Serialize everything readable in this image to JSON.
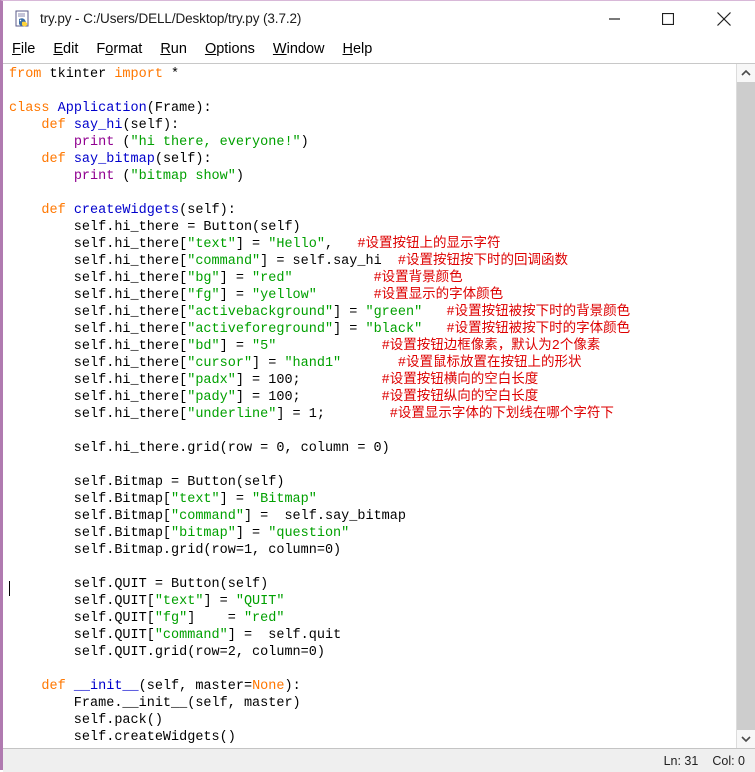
{
  "window": {
    "title": "try.py - C:/Users/DELL/Desktop/try.py (3.7.2)",
    "icon": "python-idle-icon",
    "controls": {
      "minimize": "minimize-icon",
      "maximize": "maximize-icon",
      "close": "close-icon"
    }
  },
  "menubar": {
    "items": [
      {
        "label": "File",
        "accel": "F"
      },
      {
        "label": "Edit",
        "accel": "E"
      },
      {
        "label": "Format",
        "accel": "o"
      },
      {
        "label": "Run",
        "accel": "R"
      },
      {
        "label": "Options",
        "accel": "O"
      },
      {
        "label": "Window",
        "accel": "W"
      },
      {
        "label": "Help",
        "accel": "H"
      }
    ]
  },
  "editor": {
    "lines": [
      [
        {
          "t": "from",
          "c": "kw"
        },
        {
          "t": " tkinter ",
          "c": "pl"
        },
        {
          "t": "import",
          "c": "kw"
        },
        {
          "t": " *",
          "c": "pl"
        }
      ],
      [],
      [
        {
          "t": "class",
          "c": "kw"
        },
        {
          "t": " ",
          "c": "pl"
        },
        {
          "t": "Application",
          "c": "fn"
        },
        {
          "t": "(Frame):",
          "c": "pl"
        }
      ],
      [
        {
          "t": "    ",
          "c": "pl"
        },
        {
          "t": "def",
          "c": "kw"
        },
        {
          "t": " ",
          "c": "pl"
        },
        {
          "t": "say_hi",
          "c": "fn"
        },
        {
          "t": "(self):",
          "c": "pl"
        }
      ],
      [
        {
          "t": "        ",
          "c": "pl"
        },
        {
          "t": "print",
          "c": "bi"
        },
        {
          "t": " (",
          "c": "pl"
        },
        {
          "t": "\"hi there, everyone!\"",
          "c": "str"
        },
        {
          "t": ")",
          "c": "pl"
        }
      ],
      [
        {
          "t": "    ",
          "c": "pl"
        },
        {
          "t": "def",
          "c": "kw"
        },
        {
          "t": " ",
          "c": "pl"
        },
        {
          "t": "say_bitmap",
          "c": "fn"
        },
        {
          "t": "(self):",
          "c": "pl"
        }
      ],
      [
        {
          "t": "        ",
          "c": "pl"
        },
        {
          "t": "print",
          "c": "bi"
        },
        {
          "t": " (",
          "c": "pl"
        },
        {
          "t": "\"bitmap show\"",
          "c": "str"
        },
        {
          "t": ")",
          "c": "pl"
        }
      ],
      [],
      [
        {
          "t": "    ",
          "c": "pl"
        },
        {
          "t": "def",
          "c": "kw"
        },
        {
          "t": " ",
          "c": "pl"
        },
        {
          "t": "createWidgets",
          "c": "fn"
        },
        {
          "t": "(self):",
          "c": "pl"
        }
      ],
      [
        {
          "t": "        self.hi_there = Button(self)",
          "c": "pl"
        }
      ],
      [
        {
          "t": "        self.hi_there[",
          "c": "pl"
        },
        {
          "t": "\"text\"",
          "c": "str"
        },
        {
          "t": "] = ",
          "c": "pl"
        },
        {
          "t": "\"Hello\"",
          "c": "str"
        },
        {
          "t": ",   ",
          "c": "pl"
        },
        {
          "t": "#设置按钮上的显示字符",
          "c": "cmt"
        }
      ],
      [
        {
          "t": "        self.hi_there[",
          "c": "pl"
        },
        {
          "t": "\"command\"",
          "c": "str"
        },
        {
          "t": "] = self.say_hi  ",
          "c": "pl"
        },
        {
          "t": "#设置按钮按下时的回调函数",
          "c": "cmt"
        }
      ],
      [
        {
          "t": "        self.hi_there[",
          "c": "pl"
        },
        {
          "t": "\"bg\"",
          "c": "str"
        },
        {
          "t": "] = ",
          "c": "pl"
        },
        {
          "t": "\"red\"",
          "c": "str"
        },
        {
          "t": "          ",
          "c": "pl"
        },
        {
          "t": "#设置背景颜色",
          "c": "cmt"
        }
      ],
      [
        {
          "t": "        self.hi_there[",
          "c": "pl"
        },
        {
          "t": "\"fg\"",
          "c": "str"
        },
        {
          "t": "] = ",
          "c": "pl"
        },
        {
          "t": "\"yellow\"",
          "c": "str"
        },
        {
          "t": "       ",
          "c": "pl"
        },
        {
          "t": "#设置显示的字体颜色",
          "c": "cmt"
        }
      ],
      [
        {
          "t": "        self.hi_there[",
          "c": "pl"
        },
        {
          "t": "\"activebackground\"",
          "c": "str"
        },
        {
          "t": "] = ",
          "c": "pl"
        },
        {
          "t": "\"green\"",
          "c": "str"
        },
        {
          "t": "   ",
          "c": "pl"
        },
        {
          "t": "#设置按钮被按下时的背景颜色",
          "c": "cmt"
        }
      ],
      [
        {
          "t": "        self.hi_there[",
          "c": "pl"
        },
        {
          "t": "\"activeforeground\"",
          "c": "str"
        },
        {
          "t": "] = ",
          "c": "pl"
        },
        {
          "t": "\"black\"",
          "c": "str"
        },
        {
          "t": "   ",
          "c": "pl"
        },
        {
          "t": "#设置按钮被按下时的字体颜色",
          "c": "cmt"
        }
      ],
      [
        {
          "t": "        self.hi_there[",
          "c": "pl"
        },
        {
          "t": "\"bd\"",
          "c": "str"
        },
        {
          "t": "] = ",
          "c": "pl"
        },
        {
          "t": "\"5\"",
          "c": "str"
        },
        {
          "t": "             ",
          "c": "pl"
        },
        {
          "t": "#设置按钮边框像素，默认为2个像素",
          "c": "cmt"
        }
      ],
      [
        {
          "t": "        self.hi_there[",
          "c": "pl"
        },
        {
          "t": "\"cursor\"",
          "c": "str"
        },
        {
          "t": "] = ",
          "c": "pl"
        },
        {
          "t": "\"hand1\"",
          "c": "str"
        },
        {
          "t": "       ",
          "c": "pl"
        },
        {
          "t": "#设置鼠标放置在按钮上的形状",
          "c": "cmt"
        }
      ],
      [
        {
          "t": "        self.hi_there[",
          "c": "pl"
        },
        {
          "t": "\"padx\"",
          "c": "str"
        },
        {
          "t": "] = 100;          ",
          "c": "pl"
        },
        {
          "t": "#设置按钮横向的空白长度",
          "c": "cmt"
        }
      ],
      [
        {
          "t": "        self.hi_there[",
          "c": "pl"
        },
        {
          "t": "\"pady\"",
          "c": "str"
        },
        {
          "t": "] = 100;          ",
          "c": "pl"
        },
        {
          "t": "#设置按钮纵向的空白长度",
          "c": "cmt"
        }
      ],
      [
        {
          "t": "        self.hi_there[",
          "c": "pl"
        },
        {
          "t": "\"underline\"",
          "c": "str"
        },
        {
          "t": "] = 1;        ",
          "c": "pl"
        },
        {
          "t": "#设置显示字体的下划线在哪个字符下",
          "c": "cmt"
        }
      ],
      [],
      [
        {
          "t": "        self.hi_there.grid(row = 0, column = 0)",
          "c": "pl"
        }
      ],
      [],
      [
        {
          "t": "        self.Bitmap = Button(self)",
          "c": "pl"
        }
      ],
      [
        {
          "t": "        self.Bitmap[",
          "c": "pl"
        },
        {
          "t": "\"text\"",
          "c": "str"
        },
        {
          "t": "] = ",
          "c": "pl"
        },
        {
          "t": "\"Bitmap\"",
          "c": "str"
        }
      ],
      [
        {
          "t": "        self.Bitmap[",
          "c": "pl"
        },
        {
          "t": "\"command\"",
          "c": "str"
        },
        {
          "t": "] =  self.say_bitmap",
          "c": "pl"
        }
      ],
      [
        {
          "t": "        self.Bitmap[",
          "c": "pl"
        },
        {
          "t": "\"bitmap\"",
          "c": "str"
        },
        {
          "t": "] = ",
          "c": "pl"
        },
        {
          "t": "\"question\"",
          "c": "str"
        }
      ],
      [
        {
          "t": "        self.Bitmap.grid(row=1, column=0)",
          "c": "pl"
        }
      ],
      [],
      [
        {
          "t": "        self.QUIT = Button(self)",
          "c": "pl"
        }
      ],
      [
        {
          "t": "        self.QUIT[",
          "c": "pl"
        },
        {
          "t": "\"text\"",
          "c": "str"
        },
        {
          "t": "] = ",
          "c": "pl"
        },
        {
          "t": "\"QUIT\"",
          "c": "str"
        }
      ],
      [
        {
          "t": "        self.QUIT[",
          "c": "pl"
        },
        {
          "t": "\"fg\"",
          "c": "str"
        },
        {
          "t": "]    = ",
          "c": "pl"
        },
        {
          "t": "\"red\"",
          "c": "str"
        }
      ],
      [
        {
          "t": "        self.QUIT[",
          "c": "pl"
        },
        {
          "t": "\"command\"",
          "c": "str"
        },
        {
          "t": "] =  self.quit",
          "c": "pl"
        }
      ],
      [
        {
          "t": "        self.QUIT.grid(row=2, column=0)",
          "c": "pl"
        }
      ],
      [],
      [
        {
          "t": "    ",
          "c": "pl"
        },
        {
          "t": "def",
          "c": "kw"
        },
        {
          "t": " ",
          "c": "pl"
        },
        {
          "t": "__init__",
          "c": "fn"
        },
        {
          "t": "(self, master=",
          "c": "pl"
        },
        {
          "t": "None",
          "c": "kw"
        },
        {
          "t": "):",
          "c": "pl"
        }
      ],
      [
        {
          "t": "        Frame.__init__(self, master)",
          "c": "pl"
        }
      ],
      [
        {
          "t": "        self.pack()",
          "c": "pl"
        }
      ],
      [
        {
          "t": "        self.createWidgets()",
          "c": "pl"
        }
      ]
    ]
  },
  "scrollbar": {
    "up_arrow": "chevron-up-icon",
    "down_arrow": "chevron-down-icon"
  },
  "statusbar": {
    "line_label": "Ln: 31",
    "col_label": "Col: 0"
  },
  "colors": {
    "keyword": "#ff7700",
    "function": "#0000cc",
    "string": "#00a000",
    "builtin": "#900090",
    "comment": "#dd0000",
    "window_border": "#b07ab0"
  }
}
